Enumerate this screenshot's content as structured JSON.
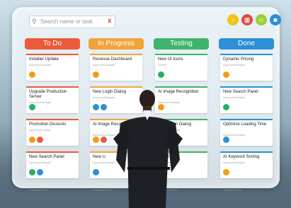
{
  "search": {
    "icon": "search-icon",
    "placeholder": "Search name or task",
    "clear": "x"
  },
  "top_icons": [
    {
      "name": "bell-icon",
      "glyph": "♪",
      "color": "#f0c419"
    },
    {
      "name": "calendar-icon",
      "glyph": "▦",
      "color": "#e0473a"
    },
    {
      "name": "chat-icon",
      "glyph": "☺",
      "color": "#9bcf3c"
    },
    {
      "name": "user-icon",
      "glyph": "☻",
      "color": "#2d8fd6"
    }
  ],
  "add_label": "+ Add New Task",
  "columns": [
    {
      "title": "To Do",
      "color": "#e95b3b",
      "cards": [
        {
          "title": "Installer Update",
          "sub": "Approved Budget",
          "bar": "#e95b3b",
          "avatars": [
            "#f39c12"
          ]
        },
        {
          "title": "Upgrade Production Server",
          "sub": "Approved Budget",
          "bar": "#e95b3b",
          "avatars": [
            "#27ae60"
          ]
        },
        {
          "title": "Promotion Dicounts",
          "sub": "Approved Budget",
          "bar": "#e95b3b",
          "avatars": [
            "#f39c12",
            "#e95b3b"
          ]
        },
        {
          "title": "New Search Panel",
          "sub": "Approved Budget",
          "bar": "#e95b3b",
          "avatars": [
            "#27ae60",
            "#2d8fd6"
          ]
        }
      ]
    },
    {
      "title": "In Progress",
      "color": "#f2a33a",
      "cards": [
        {
          "title": "Revenue Dashboard",
          "sub": "Approved Budget",
          "bar": "#f2a33a",
          "avatars": [
            "#f39c12"
          ]
        },
        {
          "title": "New Login Dialog",
          "sub": "Approved Budget",
          "bar": "#f2a33a",
          "avatars": [
            "#2d8fd6",
            "#2d8fd6"
          ]
        },
        {
          "title": "AI Image Recognition",
          "sub": "Approved Budget",
          "bar": "#f2a33a",
          "avatars": [
            "#f39c12",
            "#e95b3b"
          ]
        },
        {
          "title": "New U",
          "sub": "Approved Budget",
          "bar": "#f2a33a",
          "avatars": [
            "#2d8fd6"
          ]
        }
      ]
    },
    {
      "title": "Testing",
      "color": "#3fb36a",
      "cards": [
        {
          "title": "New UI Icons",
          "sub": "Priority",
          "bar": "#3fb36a",
          "avatars": [
            "#27ae60"
          ]
        },
        {
          "title": "AI Image Recognition",
          "sub": "Approved Budget",
          "bar": "#3fb36a",
          "avatars": [
            "#f39c12"
          ]
        },
        {
          "title": "New Login Dialog",
          "sub": "Approved Budget",
          "bar": "#3fb36a",
          "avatars": [
            "#f39c12"
          ]
        },
        {
          "title": "board",
          "sub": "Approved Budget",
          "bar": "#3fb36a",
          "avatars": []
        }
      ]
    },
    {
      "title": "Done",
      "color": "#2d8fd6",
      "cards": [
        {
          "title": "Dynamic Pricing",
          "sub": "Approved Budget",
          "bar": "#2d8fd6",
          "avatars": [
            "#f39c12"
          ]
        },
        {
          "title": "New Search Panel",
          "sub": "Approved Budget",
          "bar": "#2d8fd6",
          "avatars": [
            "#27ae60"
          ]
        },
        {
          "title": "Optimize Loading Time",
          "sub": "Approved Budget",
          "bar": "#2d8fd6",
          "avatars": [
            "#2d8fd6"
          ]
        },
        {
          "title": "AI Keyword Sorting",
          "sub": "Approved Budget",
          "bar": "#2d8fd6",
          "avatars": [
            "#f39c12"
          ]
        }
      ]
    }
  ]
}
